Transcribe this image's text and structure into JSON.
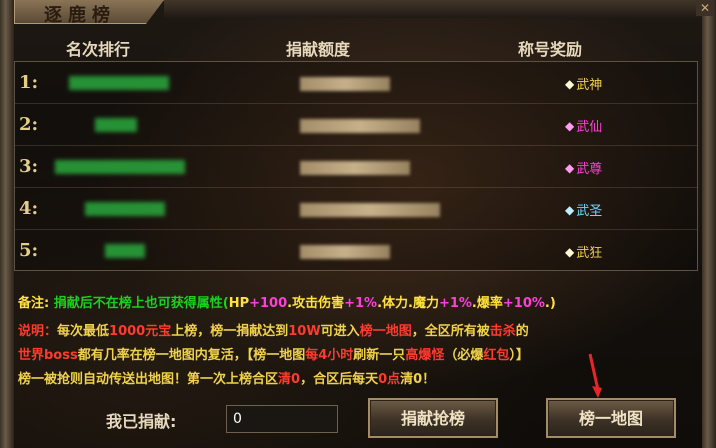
{
  "window": {
    "title": "逐鹿榜",
    "close": "✕"
  },
  "columns": {
    "rank": "名次排行",
    "amount": "捐献额度",
    "reward": "称号奖励"
  },
  "rows": [
    {
      "rank": "1:",
      "title": "武神",
      "title_color": "#f2d24a",
      "badge_icon": "gem-icon"
    },
    {
      "rank": "2:",
      "title": "武仙",
      "title_color": "#ff3fdb",
      "badge_icon": "gem-icon"
    },
    {
      "rank": "3:",
      "title": "武尊",
      "title_color": "#ff3fdb",
      "badge_icon": "gem-icon"
    },
    {
      "rank": "4:",
      "title": "武圣",
      "title_color": "#6fd7ff",
      "badge_icon": "gem-icon"
    },
    {
      "rank": "5:",
      "title": "武狂",
      "title_color": "#f2d24a",
      "badge_icon": "gem-icon"
    }
  ],
  "note": {
    "label": "备注:",
    "text1": "捐献后不在榜上也可获得属性(",
    "hp": "HP",
    "hp_val": "+100",
    "attack": ".攻击伤害",
    "attack_val": "+1%",
    "body": ".体力.魔力",
    "body_val": "+1%",
    "crit": ".爆率",
    "crit_val": "+10%",
    "end": ".)"
  },
  "desc": {
    "l1a": "说明：",
    "l1b": "每次最低",
    "l1c": "1000元宝",
    "l1d": "上榜，榜一捐献达到",
    "l1e": "10W",
    "l1f": "可进入",
    "l1g": "榜一地图",
    "l1h": "，全区所有被",
    "l1i": "击杀",
    "l1j": "的",
    "l2a": "世界boss",
    "l2b": "都有几率在榜一地图内复活，",
    "l2c": "【榜一地图",
    "l2d": "每4小时",
    "l2e": "刷新一只",
    "l2f": "高爆怪",
    "l2g": "（必爆",
    "l2h": "红包",
    "l2i": "）】",
    "l3a": "榜一被抢则自动传送出地图！第一次上榜合区",
    "l3b": "清0",
    "l3c": "，合区后每天",
    "l3d": "0点",
    "l3e": "清0！"
  },
  "footer": {
    "donate_label": "我已捐献:",
    "donate_value": "0",
    "donate_button": "捐献抢榜",
    "map_button": "榜一地图"
  },
  "colors": {
    "green": "#19d11e",
    "red": "#ff3b2e",
    "yellow": "#f2d24a",
    "pink": "#ff3fdb"
  }
}
